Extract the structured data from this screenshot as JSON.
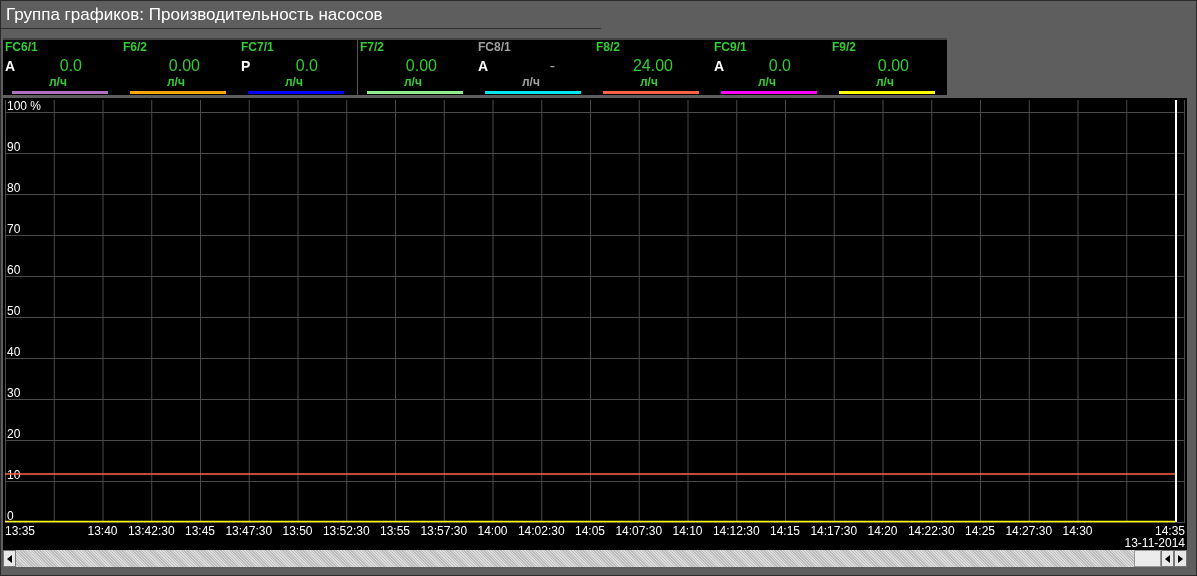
{
  "title": "Группа графиков: Производительность насосов",
  "legend": {
    "groups": [
      {
        "items": [
          {
            "tag": "FC6/1",
            "mode": "A",
            "value": "0.0",
            "units": "л/ч",
            "color": "#b070c0",
            "available": true
          },
          {
            "tag": "F6/2",
            "value": "0.00",
            "units": "л/ч",
            "color": "#ffa500",
            "available": true
          },
          {
            "tag": "FC7/1",
            "mode": "P",
            "value": "0.0",
            "units": "л/ч",
            "color": "#0000ff",
            "available": true
          }
        ]
      },
      {
        "items": [
          {
            "tag": "F7/2",
            "value": "0.00",
            "units": "л/ч",
            "color": "#90ee90",
            "available": true
          },
          {
            "tag": "FC8/1",
            "mode": "A",
            "value": "-",
            "units": "л/ч",
            "color": "#00e5ee",
            "available": false
          },
          {
            "tag": "F8/2",
            "value": "24.00",
            "units": "л/ч",
            "color": "#ff6347",
            "available": true
          },
          {
            "tag": "FC9/1",
            "mode": "A",
            "value": "0.0",
            "units": "л/ч",
            "color": "#ff00ff",
            "available": true
          },
          {
            "tag": "F9/2",
            "value": "0.00",
            "units": "л/ч",
            "color": "#ffff00",
            "available": true
          }
        ]
      }
    ]
  },
  "chart": {
    "date": "13-11-2014",
    "chart_data": {
      "type": "line",
      "categories": [
        "13:35",
        null,
        "13:40",
        "13:42:30",
        "13:45",
        "13:47:30",
        "13:50",
        "13:52:30",
        "13:55",
        "13:57:30",
        "14:00",
        "14:02:30",
        "14:05",
        "14:07:30",
        "14:10",
        "14:12:30",
        "14:15",
        "14:17:30",
        "14:20",
        "14:22:30",
        "14:25",
        "14:27:30",
        "14:30",
        null,
        "14:35"
      ],
      "series": [
        {
          "color": "#ff6347",
          "values": [
            11.8,
            11.8,
            11.8,
            11.8,
            11.8,
            11.8,
            11.8,
            11.8,
            11.8,
            11.8,
            11.8,
            11.8,
            11.8,
            11.8,
            11.8,
            11.8,
            11.8,
            11.8,
            11.8,
            11.8,
            11.8,
            11.8,
            11.8,
            11.8,
            11.8
          ]
        },
        {
          "color": "#ffff00",
          "values": [
            0,
            0,
            0,
            0,
            0,
            0,
            0,
            0,
            0,
            0,
            0,
            0,
            0,
            0,
            0,
            0,
            0,
            0,
            0,
            0,
            0,
            0,
            0,
            0,
            0
          ]
        }
      ],
      "ylim": [
        0,
        100
      ],
      "grid": true,
      "yticks": [
        0,
        10,
        20,
        30,
        40,
        50,
        60,
        70,
        80,
        90,
        {
          "value": 100,
          "label": "100 %"
        }
      ]
    }
  }
}
